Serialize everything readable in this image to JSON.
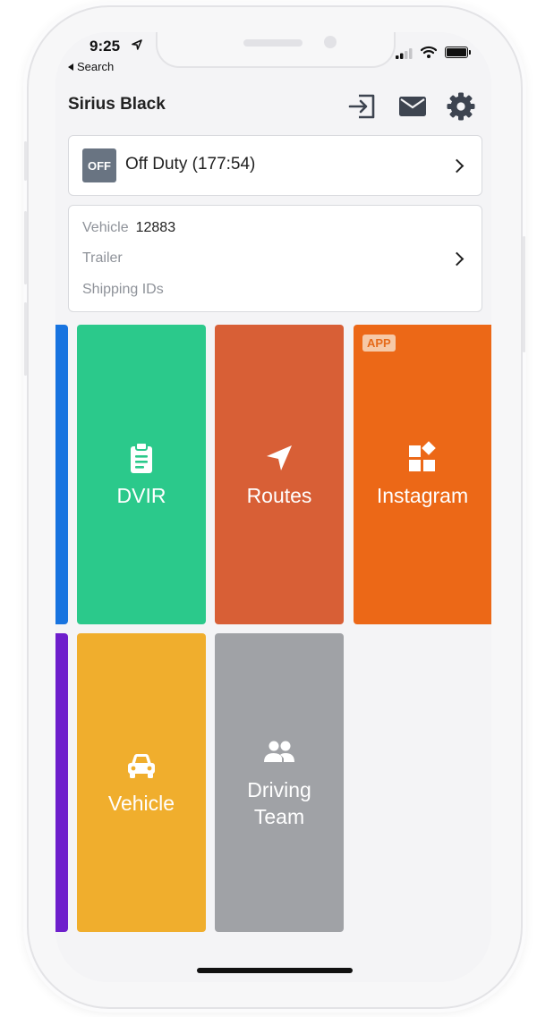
{
  "status_bar": {
    "time": "9:25",
    "back_label": "Search"
  },
  "header": {
    "driver_name": "Sirius Black"
  },
  "duty": {
    "badge": "OFF",
    "label": "Off Duty (177:54)"
  },
  "vehicle_card": {
    "vehicle_label": "Vehicle",
    "vehicle_value": "12883",
    "trailer_label": "Trailer",
    "shipping_label": "Shipping IDs"
  },
  "tiles": [
    {
      "label": "DVIR",
      "color": "#2bc98b",
      "icon": "clipboard-icon"
    },
    {
      "label": "Routes",
      "color": "#d85f36",
      "icon": "navigation-arrow-icon"
    },
    {
      "label": "Instagram",
      "color": "#ec6817",
      "icon": "apps-widget-icon",
      "badge": "APP"
    },
    {
      "label": "Vehicle",
      "color": "#f0ae2d",
      "icon": "car-icon"
    },
    {
      "label": "Driving Team",
      "color": "#a0a2a6",
      "icon": "people-icon"
    }
  ],
  "edge_tiles": {
    "top_color": "#1874e0",
    "bottom_color": "#6e1fcc"
  }
}
